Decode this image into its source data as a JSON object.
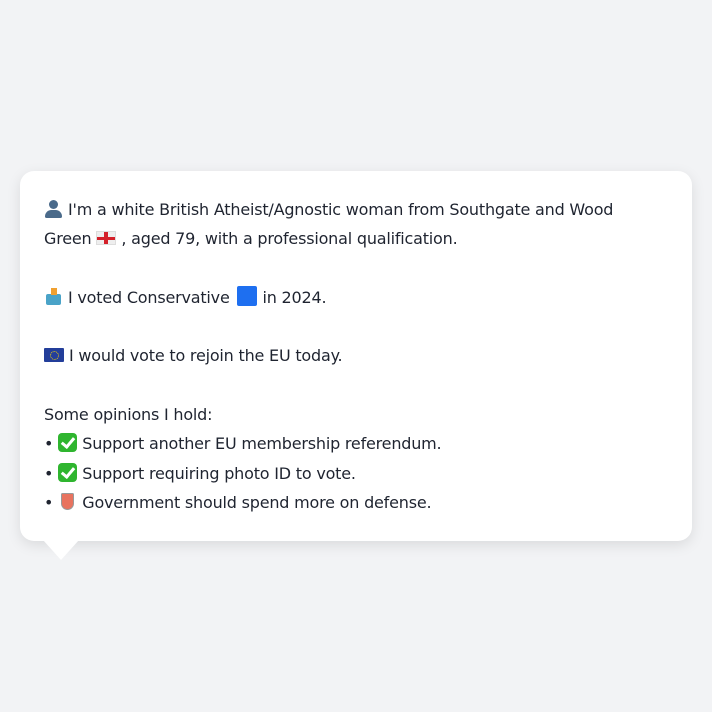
{
  "intro": {
    "line1": "I'm a white British Atheist/Agnostic woman from Southgate and Wood",
    "line2_a": "Green",
    "line2_b": ", aged 79, with a professional qualification."
  },
  "vote": {
    "a": "I voted Conservative",
    "b": "in 2024."
  },
  "eu": "I would vote to rejoin the EU today.",
  "opinions": {
    "heading": "Some opinions I hold:",
    "bullet": "•",
    "items": [
      {
        "icon": "check-icon",
        "text": "Support another EU membership referendum."
      },
      {
        "icon": "check-icon",
        "text": "Support requiring photo ID to vote."
      },
      {
        "icon": "shield-icon",
        "text": "Government should spend more on defense."
      }
    ]
  },
  "colors": {
    "conservative": "#1e6ff0",
    "check": "#2fb52f",
    "text": "#1f2430"
  }
}
